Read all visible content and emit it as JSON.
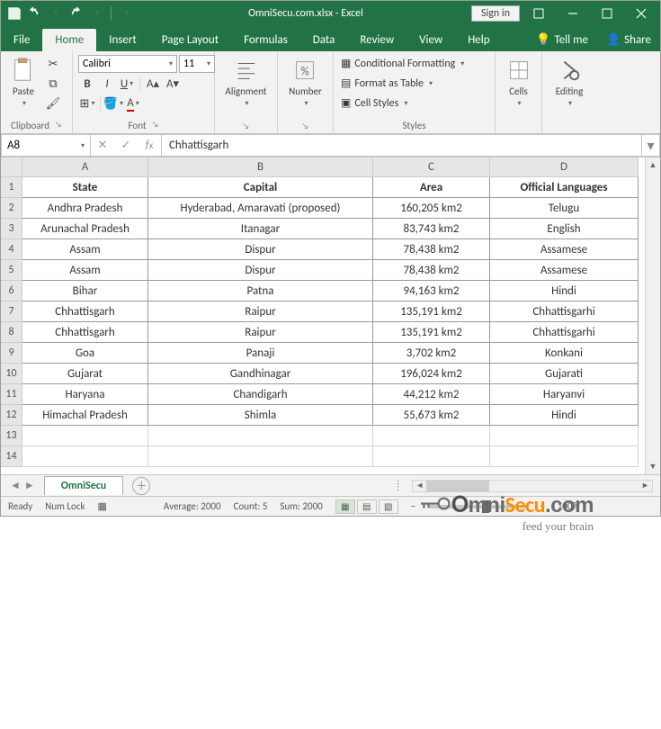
{
  "title": "OmniSecu.com.xlsx - Excel",
  "signin": "Sign in",
  "tabs": {
    "file": "File",
    "home": "Home",
    "insert": "Insert",
    "pagelayout": "Page Layout",
    "formulas": "Formulas",
    "data": "Data",
    "review": "Review",
    "view": "View",
    "help": "Help"
  },
  "tellme": "Tell me",
  "share": "Share",
  "ribbon": {
    "clipboard": {
      "label": "Clipboard",
      "paste": "Paste"
    },
    "font": {
      "label": "Font",
      "name": "Calibri",
      "size": "11"
    },
    "alignment": {
      "label": "Alignment"
    },
    "number": {
      "label": "Number"
    },
    "styles": {
      "label": "Styles",
      "cond": "Conditional Formatting",
      "fmttable": "Format as Table",
      "cellstyles": "Cell Styles"
    },
    "cells": {
      "label": "Cells"
    },
    "editing": {
      "label": "Editing"
    }
  },
  "namebox": "A8",
  "formula": "Chhattisgarh",
  "columns": [
    "A",
    "B",
    "C",
    "D"
  ],
  "headers": {
    "state": "State",
    "capital": "Capital",
    "area": "Area",
    "lang": "Official Languages"
  },
  "rows": [
    {
      "state": "Andhra Pradesh",
      "capital": "Hyderabad, Amaravati (proposed)",
      "area": "160,205 km2",
      "lang": "Telugu"
    },
    {
      "state": "Arunachal Pradesh",
      "capital": "Itanagar",
      "area": "83,743 km2",
      "lang": "English"
    },
    {
      "state": "Assam",
      "capital": "Dispur",
      "area": "78,438 km2",
      "lang": "Assamese"
    },
    {
      "state": "Assam",
      "capital": "Dispur",
      "area": "78,438 km2",
      "lang": "Assamese"
    },
    {
      "state": "Bihar",
      "capital": "Patna",
      "area": "94,163 km2",
      "lang": "Hindi"
    },
    {
      "state": "Chhattisgarh",
      "capital": "Raipur",
      "area": "135,191 km2",
      "lang": "Chhattisgarhi"
    },
    {
      "state": "Chhattisgarh",
      "capital": "Raipur",
      "area": "135,191 km2",
      "lang": "Chhattisgarhi"
    },
    {
      "state": "Goa",
      "capital": "Panaji",
      "area": "3,702 km2",
      "lang": "Konkani"
    },
    {
      "state": "Gujarat",
      "capital": "Gandhinagar",
      "area": "196,024 km2",
      "lang": "Gujarati"
    },
    {
      "state": "Haryana",
      "capital": "Chandigarh",
      "area": "44,212 km2",
      "lang": "Haryanvi"
    },
    {
      "state": "Himachal Pradesh",
      "capital": "Shimla",
      "area": "55,673 km2",
      "lang": "Hindi"
    }
  ],
  "sheet": "OmniSecu",
  "status": {
    "ready": "Ready",
    "numlock": "Num Lock",
    "avg": "Average: 2000",
    "count": "Count: 5",
    "sum": "Sum: 2000",
    "zoom": "100%"
  },
  "watermark": {
    "brand": "OmniSecu.com",
    "tag": "feed your brain"
  }
}
